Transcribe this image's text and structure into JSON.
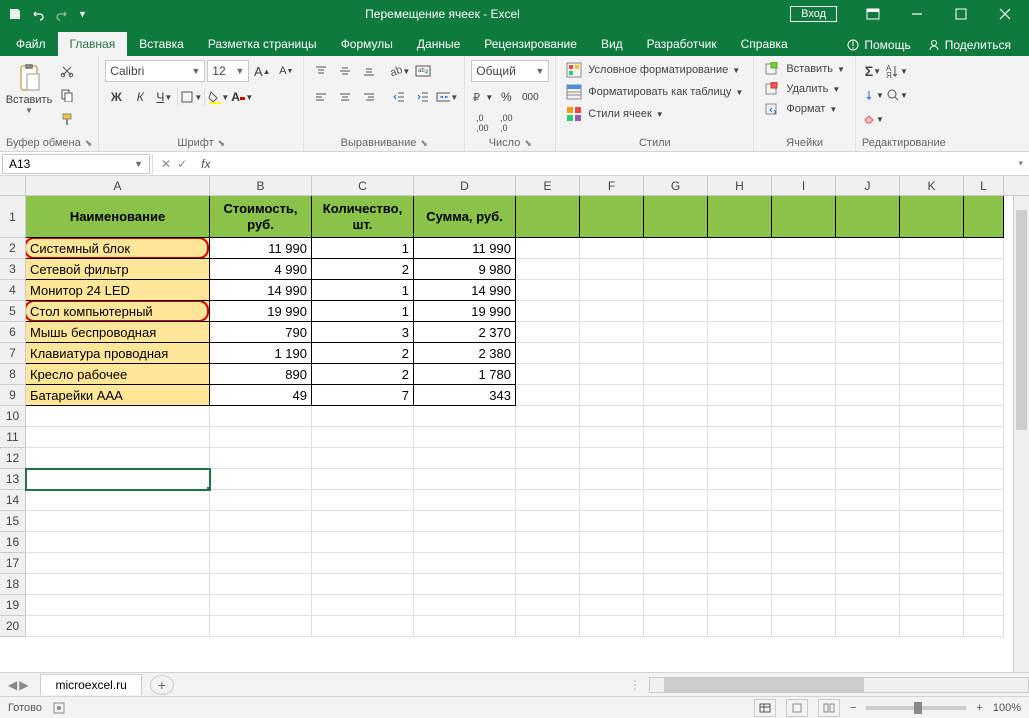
{
  "titlebar": {
    "title": "Перемещение ячеек  -  Excel",
    "login": "Вход"
  },
  "tabs": [
    "Файл",
    "Главная",
    "Вставка",
    "Разметка страницы",
    "Формулы",
    "Данные",
    "Рецензирование",
    "Вид",
    "Разработчик",
    "Справка"
  ],
  "active_tab": 1,
  "help": {
    "tell": "Помощь",
    "share": "Поделиться"
  },
  "ribbon": {
    "clipboard": {
      "paste": "Вставить",
      "label": "Буфер обмена"
    },
    "font": {
      "name": "Calibri",
      "size": "12",
      "label": "Шрифт",
      "bold": "Ж",
      "italic": "К",
      "underline": "Ч"
    },
    "alignment": {
      "label": "Выравнивание"
    },
    "number": {
      "format": "Общий",
      "label": "Число"
    },
    "styles": {
      "cond": "Условное форматирование",
      "table": "Форматировать как таблицу",
      "cell": "Стили ячеек",
      "label": "Стили"
    },
    "cells": {
      "insert": "Вставить",
      "delete": "Удалить",
      "format": "Формат",
      "label": "Ячейки"
    },
    "editing": {
      "label": "Редактирование"
    }
  },
  "name_box": "A13",
  "columns": [
    {
      "letter": "A",
      "width": 184
    },
    {
      "letter": "B",
      "width": 102
    },
    {
      "letter": "C",
      "width": 102
    },
    {
      "letter": "D",
      "width": 102
    },
    {
      "letter": "E",
      "width": 64
    },
    {
      "letter": "F",
      "width": 64
    },
    {
      "letter": "G",
      "width": 64
    },
    {
      "letter": "H",
      "width": 64
    },
    {
      "letter": "I",
      "width": 64
    },
    {
      "letter": "J",
      "width": 64
    },
    {
      "letter": "K",
      "width": 64
    },
    {
      "letter": "L",
      "width": 40
    }
  ],
  "table_header": [
    "Наименование",
    "Стоимость, руб.",
    "Количество, шт.",
    "Сумма, руб."
  ],
  "table_rows": [
    {
      "r": 2,
      "name": "Системный блок",
      "cost": "11 990",
      "qty": "1",
      "sum": "11 990",
      "highlight": true
    },
    {
      "r": 3,
      "name": "Сетевой фильтр",
      "cost": "4 990",
      "qty": "2",
      "sum": "9 980",
      "highlight": false
    },
    {
      "r": 4,
      "name": "Монитор 24 LED",
      "cost": "14 990",
      "qty": "1",
      "sum": "14 990",
      "highlight": false
    },
    {
      "r": 5,
      "name": "Стол компьютерный",
      "cost": "19 990",
      "qty": "1",
      "sum": "19 990",
      "highlight": true
    },
    {
      "r": 6,
      "name": "Мышь беспроводная",
      "cost": "790",
      "qty": "3",
      "sum": "2 370",
      "highlight": false
    },
    {
      "r": 7,
      "name": "Клавиатура проводная",
      "cost": "1 190",
      "qty": "2",
      "sum": "2 380",
      "highlight": false
    },
    {
      "r": 8,
      "name": "Кресло рабочее",
      "cost": "890",
      "qty": "2",
      "sum": "1 780",
      "highlight": false
    },
    {
      "r": 9,
      "name": "Батарейки AAA",
      "cost": "49",
      "qty": "7",
      "sum": "343",
      "highlight": false
    }
  ],
  "empty_rows": [
    10,
    11,
    12,
    13,
    14,
    15,
    16,
    17,
    18,
    19,
    20
  ],
  "selected_row": 13,
  "sheet_tab": "microexcel.ru",
  "status": {
    "ready": "Готово",
    "zoom": "100%"
  }
}
